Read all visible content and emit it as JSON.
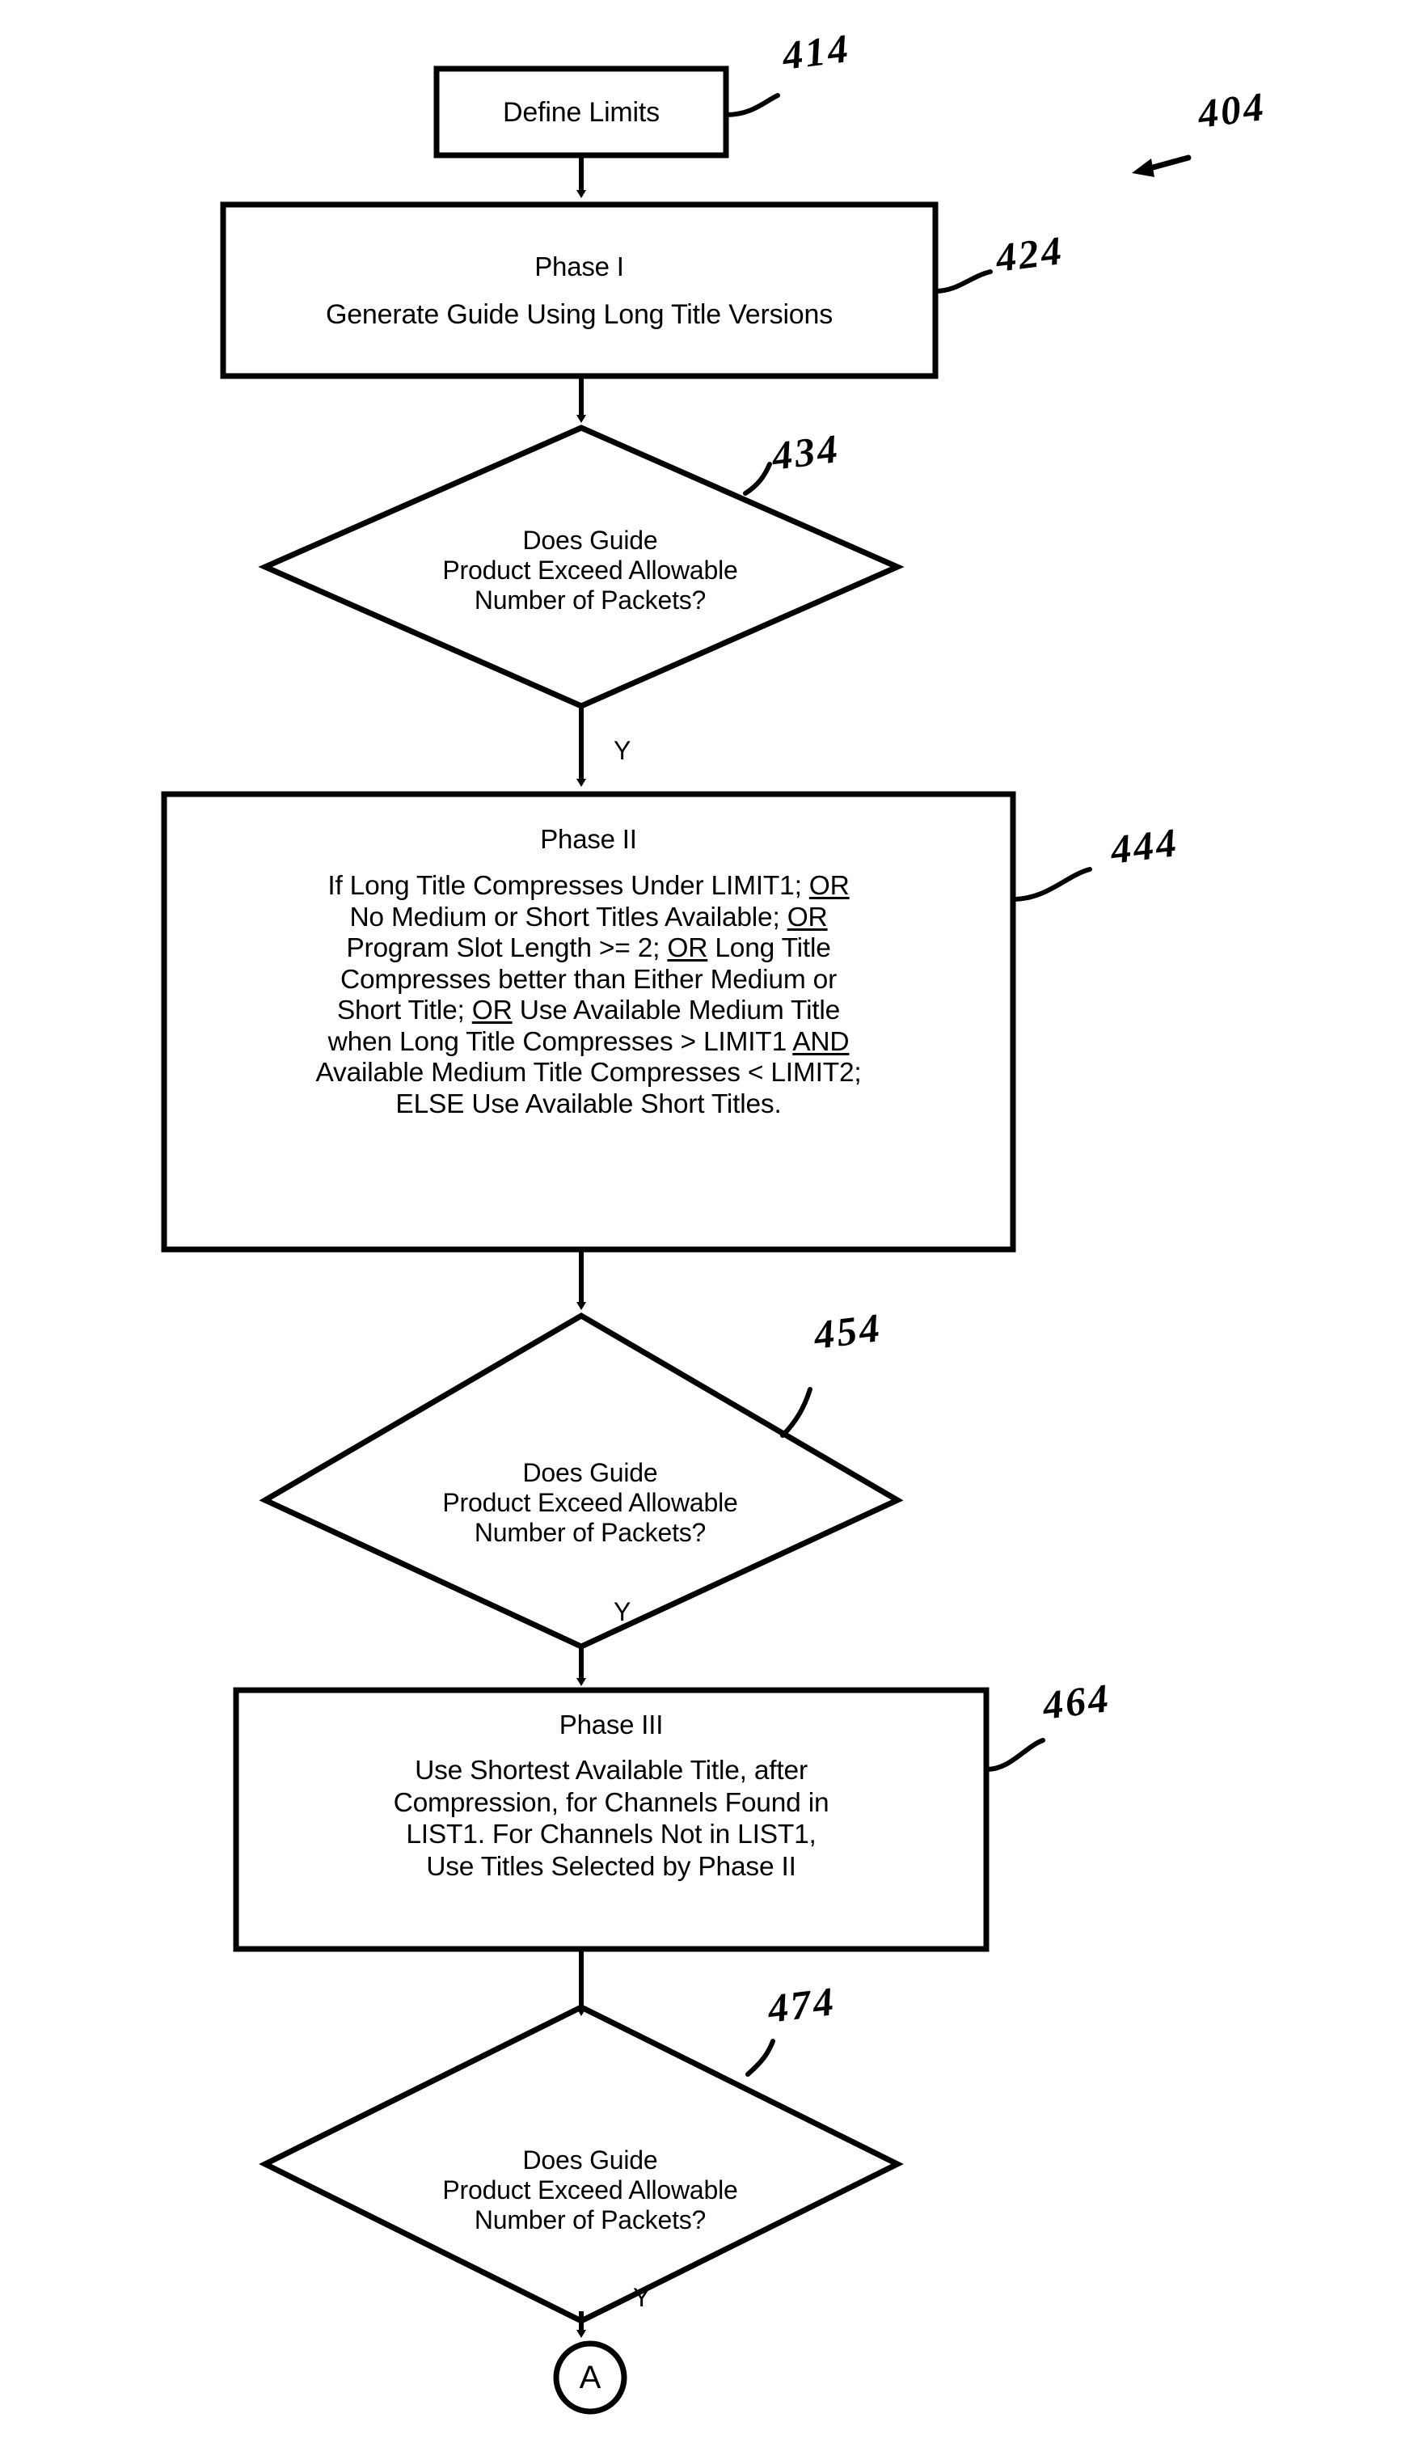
{
  "figure": {
    "figure_ref": "404",
    "nodes": {
      "define_limits": {
        "ref": "414",
        "shape": "process",
        "lines": [
          "Define Limits"
        ]
      },
      "phase1": {
        "ref": "424",
        "shape": "process",
        "title": "Phase I",
        "lines": [
          "Generate Guide Using Long Title Versions"
        ]
      },
      "decision1": {
        "ref": "434",
        "shape": "decision",
        "lines": [
          "Does Guide",
          "Product Exceed Allowable",
          "Number of Packets?"
        ],
        "branch_label": "Y"
      },
      "phase2": {
        "ref": "444",
        "shape": "process",
        "title": "Phase II",
        "lines": [
          "If Long Title Compresses Under LIMIT1; OR",
          "No Medium or Short Titles Available; OR",
          "Program Slot Length >=  2; OR Long Title",
          "Compresses better than Either Medium or",
          "Short Title; OR Use  Available Medium Title",
          "when Long Title Compresses > LIMIT1 AND",
          "Available Medium Title Compresses < LIMIT2;",
          "ELSE Use Available Short Titles."
        ]
      },
      "decision2": {
        "ref": "454",
        "shape": "decision",
        "lines": [
          "Does Guide",
          "Product Exceed Allowable",
          "Number of Packets?"
        ],
        "branch_label": "Y"
      },
      "phase3": {
        "ref": "464",
        "shape": "process",
        "title": "Phase III",
        "lines": [
          "Use Shortest Available Title, after",
          "Compression, for Channels Found in",
          "LIST1. For Channels Not in LIST1,",
          "Use Titles Selected by Phase II"
        ]
      },
      "decision3": {
        "ref": "474",
        "shape": "decision",
        "lines": [
          "Does Guide",
          "Product Exceed Allowable",
          "Number of Packets?"
        ],
        "branch_label": "Y"
      },
      "connector_a": {
        "shape": "connector",
        "label": "A"
      }
    },
    "colors": {
      "stroke": "#000000",
      "background": "#ffffff",
      "text": "#000000"
    }
  }
}
